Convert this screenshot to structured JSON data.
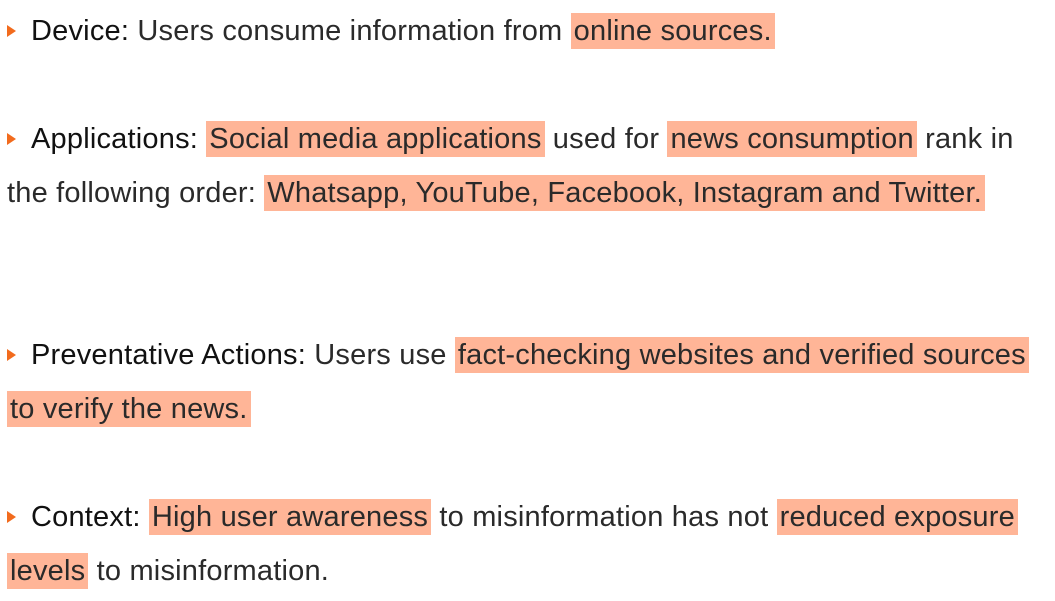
{
  "colors": {
    "highlight": "#ffb597",
    "bullet_arrow": "#f26b1d",
    "text": "#1a1a1a"
  },
  "bullet_icon": "orange-triangle-arrow",
  "items": [
    {
      "label": "Device:",
      "segments": [
        {
          "text": " Users consume information from ",
          "hl": false
        },
        {
          "text": "online sources.",
          "hl": true
        }
      ]
    },
    {
      "label": "Applications:",
      "segments": [
        {
          "text": " ",
          "hl": false
        },
        {
          "text": "Social media applications",
          "hl": true
        },
        {
          "text": " used for ",
          "hl": false
        },
        {
          "text": "news consumption",
          "hl": true
        },
        {
          "text": " rank in the following order: ",
          "hl": false
        },
        {
          "text": "Whatsapp, YouTube, Facebook, Instagram and Twitter.",
          "hl": true
        }
      ]
    },
    {
      "label": "Preventative Actions:",
      "segments": [
        {
          "text": " Users use ",
          "hl": false
        },
        {
          "text": "fact-checking websites and verified sources to verify the news.",
          "hl": true
        }
      ]
    },
    {
      "label": "Context:",
      "segments": [
        {
          "text": " ",
          "hl": false
        },
        {
          "text": "High user awareness",
          "hl": true
        },
        {
          "text": " to misinformation has not ",
          "hl": false
        },
        {
          "text": "reduced exposure levels",
          "hl": true
        },
        {
          "text": " to misinformation.",
          "hl": false
        }
      ]
    }
  ]
}
